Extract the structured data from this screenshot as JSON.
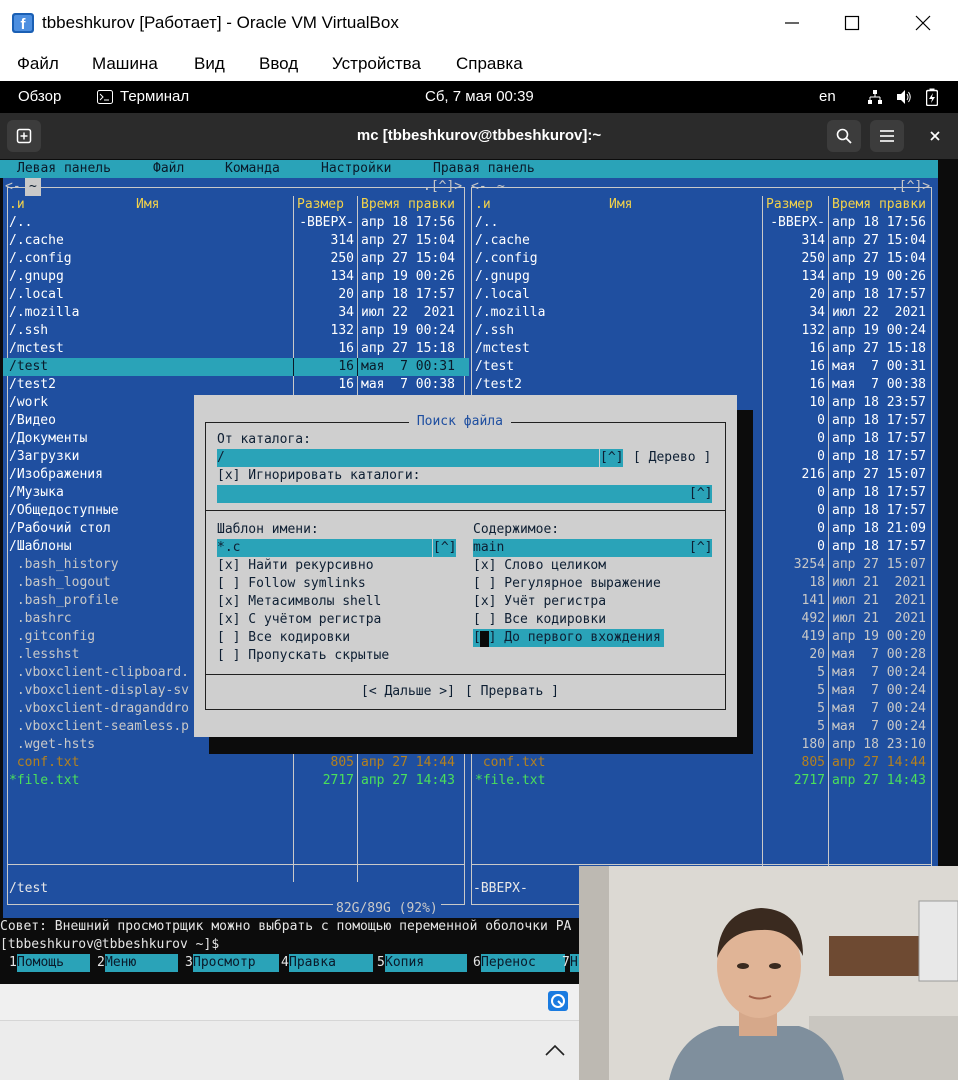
{
  "window": {
    "title": "tbbeshkurov [Работает] - Oracle VM VirtualBox",
    "menu": [
      "Файл",
      "Машина",
      "Вид",
      "Ввод",
      "Устройства",
      "Справка"
    ]
  },
  "gnome": {
    "overview": "Обзор",
    "app": "Терминал",
    "clock": "Сб, 7 мая  00:39",
    "lang": "en"
  },
  "terminal": {
    "title": "mc [tbbeshkurov@tbbeshkurov]:~"
  },
  "mc": {
    "menu": [
      "Левая панель",
      "Файл",
      "Команда",
      "Настройки",
      "Правая панель"
    ],
    "left_path": "~",
    "right_path": "~",
    "arrows": ".[^]>",
    "columns": {
      "n": ".и",
      "name": "Имя",
      "size": "Размер",
      "mtime": "Время правки"
    },
    "left_rows": [
      {
        "name": "/..",
        "size": "-ВВЕРХ-",
        "mtime": "апр 18 17:56",
        "kind": "dir"
      },
      {
        "name": "/.cache",
        "size": "314",
        "mtime": "апр 27 15:04",
        "kind": "dir"
      },
      {
        "name": "/.config",
        "size": "250",
        "mtime": "апр 27 15:04",
        "kind": "dir"
      },
      {
        "name": "/.gnupg",
        "size": "134",
        "mtime": "апр 19 00:26",
        "kind": "dir"
      },
      {
        "name": "/.local",
        "size": "20",
        "mtime": "апр 18 17:57",
        "kind": "dir"
      },
      {
        "name": "/.mozilla",
        "size": "34",
        "mtime": "июл 22  2021",
        "kind": "dir"
      },
      {
        "name": "/.ssh",
        "size": "132",
        "mtime": "апр 19 00:24",
        "kind": "dir"
      },
      {
        "name": "/mctest",
        "size": "16",
        "mtime": "апр 27 15:18",
        "kind": "dir"
      },
      {
        "name": "/test",
        "size": "16",
        "mtime": "мая  7 00:31",
        "kind": "dir",
        "selected": true
      },
      {
        "name": "/test2",
        "size": "16",
        "mtime": "мая  7 00:38",
        "kind": "dir"
      },
      {
        "name": "/work",
        "size": "",
        "mtime": "",
        "kind": "dir"
      },
      {
        "name": "/Видео",
        "size": "",
        "mtime": "",
        "kind": "dir"
      },
      {
        "name": "/Документы",
        "size": "",
        "mtime": "",
        "kind": "dir"
      },
      {
        "name": "/Загрузки",
        "size": "",
        "mtime": "",
        "kind": "dir"
      },
      {
        "name": "/Изображения",
        "size": "",
        "mtime": "",
        "kind": "dir"
      },
      {
        "name": "/Музыка",
        "size": "",
        "mtime": "",
        "kind": "dir"
      },
      {
        "name": "/Общедоступные",
        "size": "",
        "mtime": "",
        "kind": "dir"
      },
      {
        "name": "/Рабочий стол",
        "size": "",
        "mtime": "",
        "kind": "dir"
      },
      {
        "name": "/Шаблоны",
        "size": "",
        "mtime": "",
        "kind": "dir"
      },
      {
        "name": " .bash_history",
        "size": "",
        "mtime": "",
        "kind": "file"
      },
      {
        "name": " .bash_logout",
        "size": "",
        "mtime": "",
        "kind": "file"
      },
      {
        "name": " .bash_profile",
        "size": "",
        "mtime": "",
        "kind": "file"
      },
      {
        "name": " .bashrc",
        "size": "",
        "mtime": "",
        "kind": "file"
      },
      {
        "name": " .gitconfig",
        "size": "",
        "mtime": "",
        "kind": "file"
      },
      {
        "name": " .lesshst",
        "size": "",
        "mtime": "",
        "kind": "file"
      },
      {
        "name": " .vboxclient-clipboard.",
        "size": "",
        "mtime": "",
        "kind": "file"
      },
      {
        "name": " .vboxclient-display-sv",
        "size": "",
        "mtime": "",
        "kind": "file"
      },
      {
        "name": " .vboxclient-draganddro",
        "size": "",
        "mtime": "",
        "kind": "file"
      },
      {
        "name": " .vboxclient-seamless.p",
        "size": "",
        "mtime": "",
        "kind": "file"
      },
      {
        "name": " .wget-hsts",
        "size": "180",
        "mtime": "апр 18 23:10",
        "kind": "file"
      },
      {
        "name": " conf.txt",
        "size": "805",
        "mtime": "апр 27 14:44",
        "kind": "dim"
      },
      {
        "name": "*file.txt",
        "size": "2717",
        "mtime": "апр 27 14:43",
        "kind": "exec"
      }
    ],
    "right_rows": [
      {
        "name": "/..",
        "size": "-ВВЕРХ-",
        "mtime": "апр 18 17:56",
        "kind": "dir"
      },
      {
        "name": "/.cache",
        "size": "314",
        "mtime": "апр 27 15:04",
        "kind": "dir"
      },
      {
        "name": "/.config",
        "size": "250",
        "mtime": "апр 27 15:04",
        "kind": "dir"
      },
      {
        "name": "/.gnupg",
        "size": "134",
        "mtime": "апр 19 00:26",
        "kind": "dir"
      },
      {
        "name": "/.local",
        "size": "20",
        "mtime": "апр 18 17:57",
        "kind": "dir"
      },
      {
        "name": "/.mozilla",
        "size": "34",
        "mtime": "июл 22  2021",
        "kind": "dir"
      },
      {
        "name": "/.ssh",
        "size": "132",
        "mtime": "апр 19 00:24",
        "kind": "dir"
      },
      {
        "name": "/mctest",
        "size": "16",
        "mtime": "апр 27 15:18",
        "kind": "dir"
      },
      {
        "name": "/test",
        "size": "16",
        "mtime": "мая  7 00:31",
        "kind": "dir"
      },
      {
        "name": "/test2",
        "size": "16",
        "mtime": "мая  7 00:38",
        "kind": "dir"
      },
      {
        "name": "",
        "size": "10",
        "mtime": "апр 18 23:57",
        "kind": "dir"
      },
      {
        "name": "",
        "size": "0",
        "mtime": "апр 18 17:57",
        "kind": "dir"
      },
      {
        "name": "",
        "size": "0",
        "mtime": "апр 18 17:57",
        "kind": "dir"
      },
      {
        "name": "",
        "size": "0",
        "mtime": "апр 18 17:57",
        "kind": "dir"
      },
      {
        "name": "",
        "size": "216",
        "mtime": "апр 27 15:07",
        "kind": "dir"
      },
      {
        "name": "",
        "size": "0",
        "mtime": "апр 18 17:57",
        "kind": "dir"
      },
      {
        "name": "",
        "size": "0",
        "mtime": "апр 18 17:57",
        "kind": "dir"
      },
      {
        "name": "",
        "size": "0",
        "mtime": "апр 18 21:09",
        "kind": "dir"
      },
      {
        "name": "",
        "size": "0",
        "mtime": "апр 18 17:57",
        "kind": "dir"
      },
      {
        "name": "",
        "size": "3254",
        "mtime": "апр 27 15:07",
        "kind": "file"
      },
      {
        "name": "",
        "size": "18",
        "mtime": "июл 21  2021",
        "kind": "file"
      },
      {
        "name": "",
        "size": "141",
        "mtime": "июл 21  2021",
        "kind": "file"
      },
      {
        "name": "",
        "size": "492",
        "mtime": "июл 21  2021",
        "kind": "file"
      },
      {
        "name": "",
        "size": "419",
        "mtime": "апр 19 00:20",
        "kind": "file"
      },
      {
        "name": "",
        "size": "20",
        "mtime": "мая  7 00:28",
        "kind": "file"
      },
      {
        "name": "",
        "size": "5",
        "mtime": "мая  7 00:24",
        "kind": "file"
      },
      {
        "name": "",
        "size": "5",
        "mtime": "мая  7 00:24",
        "kind": "file"
      },
      {
        "name": "",
        "size": "5",
        "mtime": "мая  7 00:24",
        "kind": "file"
      },
      {
        "name": "",
        "size": "5",
        "mtime": "мая  7 00:24",
        "kind": "file"
      },
      {
        "name": " .wget-hsts",
        "size": "180",
        "mtime": "апр 18 23:10",
        "kind": "file"
      },
      {
        "name": " conf.txt",
        "size": "805",
        "mtime": "апр 27 14:44",
        "kind": "dim"
      },
      {
        "name": "*file.txt",
        "size": "2717",
        "mtime": "апр 27 14:43",
        "kind": "exec"
      }
    ],
    "left_status": "/test",
    "right_status": "-ВВЕРХ-",
    "disk": "82G/89G (92%)",
    "hint": "Совет: Внешний просмотрщик можно выбрать с помощью переменной оболочки PA",
    "prompt": "[tbbeshkurov@tbbeshkurov ~]$",
    "fkeys": [
      {
        "n": "1",
        "label": "Помощь"
      },
      {
        "n": "2",
        "label": "Меню"
      },
      {
        "n": "3",
        "label": "Просмотр"
      },
      {
        "n": "4",
        "label": "Правка"
      },
      {
        "n": "5",
        "label": "Копия"
      },
      {
        "n": "6",
        "label": "Перенос"
      },
      {
        "n": "7",
        "label": "Н"
      }
    ]
  },
  "dialog": {
    "title": " Поиск файла ",
    "from_dir_label": "От каталога:",
    "from_dir_value": "/",
    "history_btn": "[^]",
    "tree_btn": "[ Дерево ]",
    "ignore_dirs": "[x] Игнорировать каталоги:",
    "ignore_value": "",
    "name_label": "Шаблон имени:",
    "name_value": "*.c",
    "content_label": "Содержимое:",
    "content_value": "main",
    "left_opts": [
      "[x] Найти рекурсивно",
      "[ ] Follow symlinks",
      "[x] Метасимволы shell",
      "[x] С учётом регистра",
      "[ ] Все кодировки",
      "[ ] Пропускать скрытые"
    ],
    "right_opts": [
      "[x] Слово целиком",
      "[ ] Регулярное выражение",
      "[x] Учёт регистра",
      "[ ] Все кодировки",
      "[ ] До первого вхождения"
    ],
    "ok_btn": "[< Дальше >]",
    "cancel_btn": "[ Прервать ]"
  }
}
